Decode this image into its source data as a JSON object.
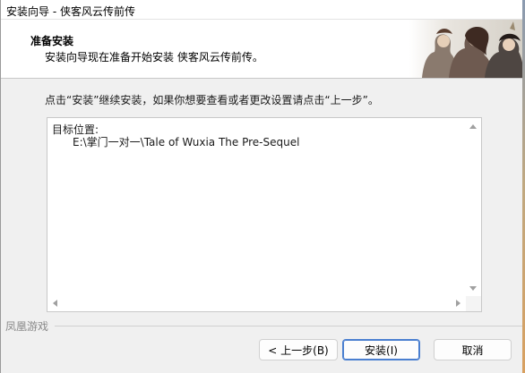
{
  "window": {
    "title": "安装向导 - 侠客风云传前传"
  },
  "header": {
    "title": "准备安装",
    "subtitle": "安装向导现在准备开始安装 侠客风云传前传。"
  },
  "main": {
    "instruction": "点击“安装”继续安装，如果你想要查看或者更改设置请点击“上一步”。",
    "info_label": "目标位置:",
    "info_path": "E:\\掌门一对一\\Tale of Wuxia The Pre-Sequel"
  },
  "footer": {
    "brand": "凤凰游戏"
  },
  "buttons": {
    "back": "< 上一步(B)",
    "install": "安装(I)",
    "cancel": "取消"
  },
  "colors": {
    "accent": "#4a7fd0",
    "window_bg": "#f0f0f0"
  }
}
